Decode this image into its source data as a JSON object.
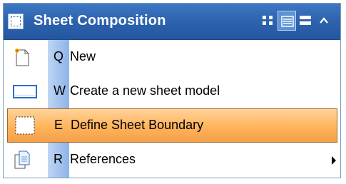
{
  "header": {
    "title": "Sheet Composition",
    "view_buttons": [
      {
        "icon": "grid-view-icon",
        "active": false
      },
      {
        "icon": "list-view-icon",
        "active": true
      },
      {
        "icon": "detail-view-icon",
        "active": false
      },
      {
        "icon": "collapse-chevron-icon",
        "active": false
      }
    ]
  },
  "items": [
    {
      "key": "Q",
      "label": "New",
      "icon": "new-document-icon"
    },
    {
      "key": "W",
      "label": "Create a new sheet model",
      "icon": "sheet-model-icon"
    },
    {
      "key": "E",
      "label": "Define Sheet Boundary",
      "icon": "sheet-boundary-icon",
      "selected": true
    },
    {
      "key": "R",
      "label": "References",
      "icon": "references-icon",
      "has_submenu": true
    }
  ],
  "colors": {
    "header": "#2d62ad",
    "selection": "#ffb35a",
    "gutter": "#8eb3ea"
  }
}
